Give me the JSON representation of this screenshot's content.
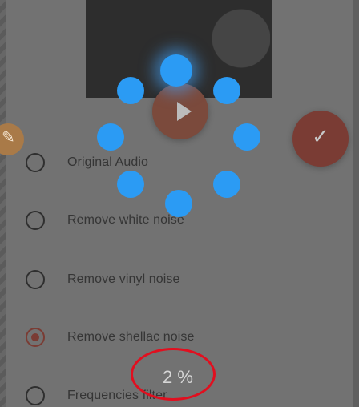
{
  "options": [
    {
      "label": "Original Audio",
      "selected": false
    },
    {
      "label": "Remove white noise",
      "selected": false
    },
    {
      "label": "Remove vinyl noise",
      "selected": false
    },
    {
      "label": "Remove shellac noise",
      "selected": true
    },
    {
      "label": "Frequencies filter",
      "selected": false
    }
  ],
  "progress": {
    "text": "2 %",
    "value_percent": 2
  },
  "icons": {
    "play": "play-icon",
    "edit": "edit-icon",
    "confirm": "check-icon"
  },
  "colors": {
    "accent_dark": "#7a3c34",
    "spinner_blue": "#2b9bf4",
    "highlight_red": "#e10f1f"
  }
}
